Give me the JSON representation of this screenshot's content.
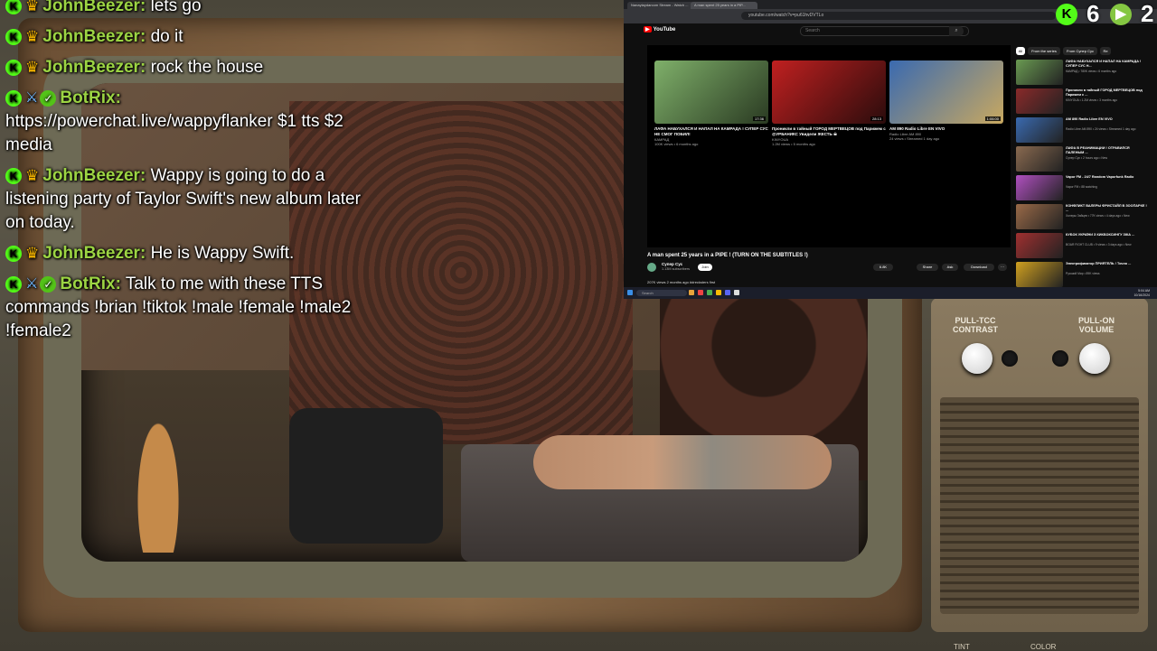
{
  "chat": {
    "messages": [
      {
        "user": "JohnBeezer",
        "sep": ":",
        "text": "lets go",
        "badges": [
          "kick",
          "crown"
        ]
      },
      {
        "user": "JohnBeezer",
        "sep": ":",
        "text": "do it",
        "badges": [
          "kick",
          "crown"
        ]
      },
      {
        "user": "JohnBeezer",
        "sep": ":",
        "text": "rock the house",
        "badges": [
          "kick",
          "crown"
        ]
      },
      {
        "user": "BotRix",
        "sep": ":",
        "text": "https://powerchat.live/wappyflanker $1 tts $2 media",
        "badges": [
          "kick",
          "sword",
          "verified"
        ]
      },
      {
        "user": "JohnBeezer",
        "sep": ":",
        "text": "Wappy is going to do a listening party of Taylor Swift's new album later on today.",
        "badges": [
          "kick",
          "crown"
        ]
      },
      {
        "user": "JohnBeezer",
        "sep": ":",
        "text": "He is Wappy Swift.",
        "badges": [
          "kick",
          "crown"
        ]
      },
      {
        "user": "BotRix",
        "sep": ":",
        "text": "Talk to me with these TTS commands !brian !tiktok !male !female !male2 !female2",
        "badges": [
          "kick",
          "sword",
          "verified"
        ]
      }
    ]
  },
  "counters": {
    "kick_viewers": "6",
    "rumble_viewers": "2",
    "kick_glyph": "K",
    "rumble_glyph": "▶"
  },
  "tv": {
    "label_left": "PULL-TCC CONTRAST",
    "label_right": "PULL-ON VOLUME",
    "bottom_left": "TINT",
    "bottom_right": "COLOR"
  },
  "browser": {
    "tabs": [
      "Nanaytaydarcom Stream - Watch ...",
      "A man spent 25 years in a PIP..."
    ],
    "address": "youtube.com/watch?v=pu61hvDVTLo",
    "logo": "YouTube",
    "search_placeholder": "Search",
    "video_title": "A man spent 25 years in a PIPE ! (TURN ON THE SUBTITLES !)",
    "channel_name": "Супер Сус",
    "channel_subs": "1.13M subscribers",
    "join_label": "Join",
    "like_count": "6.8K",
    "share_label": "Share",
    "ask_label": "Ask",
    "download_label": "Download",
    "description": "207K views  2 months ago  #drecksters first",
    "cards": [
      {
        "title": "ЛАФА НАБУХАЛСЯ И НАПАЛ НА КАМРАДА ! СУПЕР СУС НЕ СМОГ ПОБИЛ!",
        "channel": "КАМРАД",
        "meta": "100K views • 6 months ago",
        "duration": "17:36",
        "color1": "#7fb06a",
        "color2": "#2a3a22"
      },
      {
        "title": "Проникли в тайный ГОРОД МЕРТВЕЦОВ под Парижем с @УРБАНИКС Увидели ЖЕСТЬ ☠",
        "channel": "KINYOUA",
        "meta": "1.2M views • 5 months ago",
        "duration": "28:13",
        "color1": "#c02020",
        "color2": "#2a0c0c"
      },
      {
        "title": "AM 890 Radio Libre EN VIVO",
        "channel": "Radio Libre AM 890",
        "meta": "24 views • Streamed 1 day ago",
        "duration": "1:06:00",
        "color1": "#3a6ab0",
        "color2": "#c8a860"
      }
    ],
    "chips": [
      "All",
      "From the series",
      "From Супер Сус",
      "Re"
    ],
    "sidebar": [
      {
        "title": "ЛАФА НАБУХАЛСЯ И НАПАЛ НА КАМРАДА ! СУПЕР СУС Н...",
        "meta": "КАМРАД • 780K views • 6 months ago",
        "color": "#6a9a52"
      },
      {
        "title": "Проникли в тайный ГОРОД МЕРТВЕЦОВ под Парижем с ...",
        "meta": "KINYOUA • 1.2M views • 3 months ago",
        "color": "#8a2a2a"
      },
      {
        "title": "AM 890 Radio Libre EN VIVO",
        "meta": "Radio Libre AM 890 • 24 views • Streamed 1 day ago",
        "color": "#3a6ab0"
      },
      {
        "title": "ЛАФА В РЕАНИМАЦИИ ! ОТРАВИЛСЯ ПАЛЕНЫМ ...",
        "meta": "Супер Сус • 2 hours ago • New",
        "color": "#8a6a50"
      },
      {
        "title": "Vapor FM - 24/7 Random Vaporfunk Radio",
        "meta": "Vapor FM • 88 watching",
        "color": "#b050c0"
      },
      {
        "title": "КОНФЛИКТ ВАЛЕРЫ ФРИСТАЙЛ В ЗООПАРКЕ ! ...",
        "meta": "Холеры Зайцев • 77K views • 4 days ago • New",
        "color": "#9a6a48"
      },
      {
        "title": "КУБОК УКРАЇНИ З КИКБОКСИНГУ ЗІКА ...",
        "meta": "BOAR FIGHT CLUB • 9 views • 3 days ago • New",
        "color": "#a03030"
      },
      {
        "title": "Электрификатор ПРИЯТЕЛЬ ! Точно ...",
        "meta": "Русский Мир • 89K views",
        "color": "#d0a020"
      }
    ],
    "taskbar_search": "Search",
    "clock_time": "5:04 AM",
    "clock_date": "10/16/2024"
  }
}
